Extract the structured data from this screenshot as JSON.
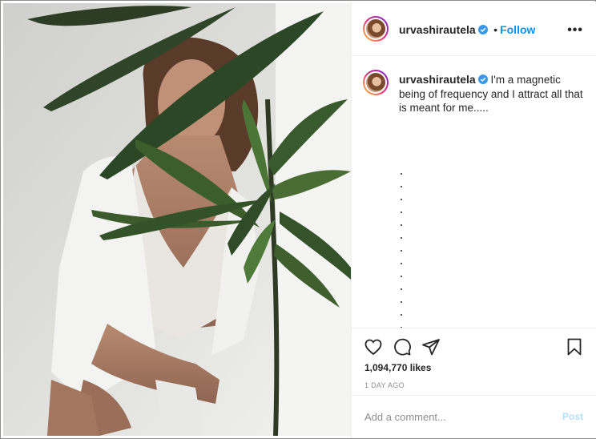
{
  "post": {
    "username": "urvashirautela",
    "follow_label": "Follow",
    "more_label": "•••",
    "caption": "I'm a magnetic being of frequency and I attract all that is meant for me.....",
    "likes": "1,094,770 likes",
    "time": "1 DAY AGO"
  },
  "comment": {
    "placeholder": "Add a comment...",
    "post_label": "Post"
  },
  "icons": [
    "heart-icon",
    "comment-icon",
    "share-icon",
    "bookmark-icon",
    "verified-icon",
    "more-options-icon"
  ],
  "colors": {
    "accent": "#0095f6",
    "text": "#262626",
    "muted": "#8e8e8e",
    "post_disabled": "#b2dffc",
    "verified": "#3897f0"
  }
}
